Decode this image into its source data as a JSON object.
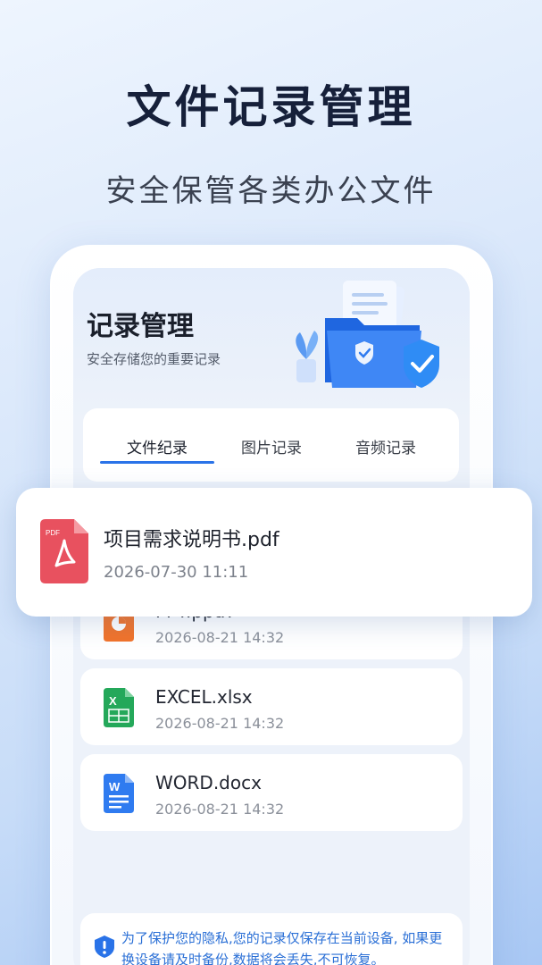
{
  "headline": "文件记录管理",
  "subheadline": "安全保管各类办公文件",
  "app": {
    "title": "记录管理",
    "subtitle": "安全存储您的重要记录"
  },
  "tabs": [
    {
      "label": "文件纪录",
      "active": true
    },
    {
      "label": "图片记录",
      "active": false
    },
    {
      "label": "音频记录",
      "active": false
    }
  ],
  "highlighted_file": {
    "name": "项目需求说明书.pdf",
    "date": "2026-07-30 11:11",
    "icon": "pdf-file-icon",
    "icon_label": "PDF"
  },
  "files": [
    {
      "name": "PPT.pptx",
      "date": "2026-08-21 14:32",
      "icon": "ppt-file-icon"
    },
    {
      "name": "EXCEL.xlsx",
      "date": "2026-08-21 14:32",
      "icon": "excel-file-icon",
      "icon_letter": "X"
    },
    {
      "name": "WORD.docx",
      "date": "2026-08-21 14:32",
      "icon": "word-file-icon",
      "icon_letter": "W"
    }
  ],
  "notice": {
    "text": "为了保护您的隐私,您的记录仅保存在当前设备, 如果更换设备请及时备份,数据将会丢失,不可恢复。",
    "icon": "info-icon"
  },
  "colors": {
    "accent": "#2a73e8",
    "pdf": "#e8515f",
    "ppt": "#f2732a",
    "excel": "#24a85a",
    "word": "#2f7bf0"
  }
}
